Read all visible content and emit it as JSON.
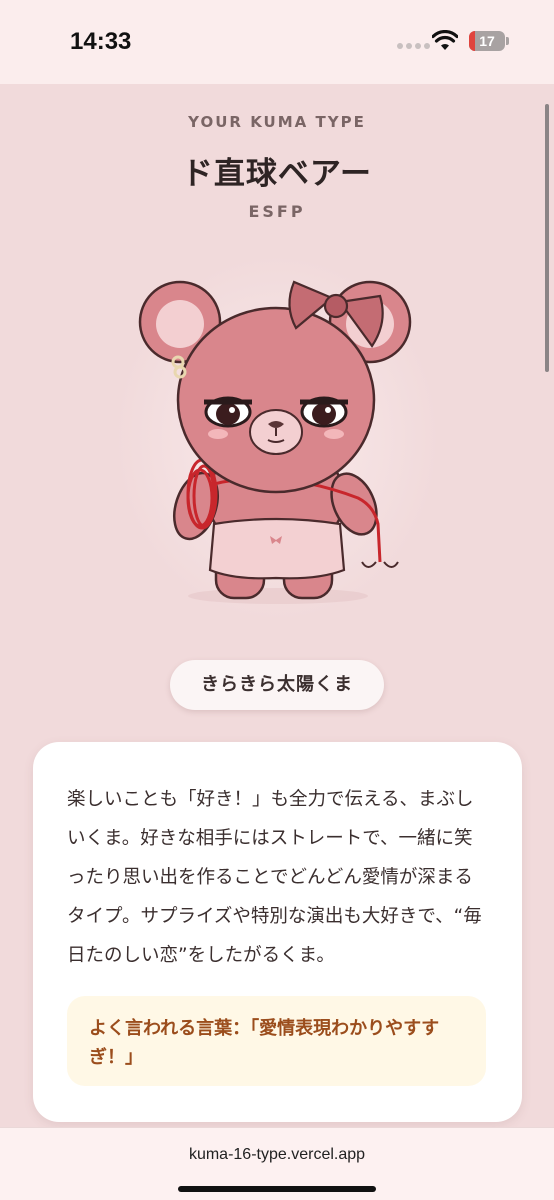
{
  "status_bar": {
    "time": "14:33",
    "battery_level": "17",
    "battery_fraction": 0.17
  },
  "header": {
    "eyebrow": "YOUR KUMA TYPE",
    "type_name": "ド直球ベアー",
    "type_code": "ESFP"
  },
  "illustration": {
    "icon": "pink-bear-with-rope-illustration"
  },
  "nickname": "きらきら太陽くま",
  "card": {
    "description": "楽しいことも「好き！」も全力で伝える、まぶしいくま。好きな相手にはストレートで、一緒に笑ったり思い出を作ることでどんどん愛情が深まるタイプ。サプライズや特別な演出も大好きで、“毎日たのしい恋”をしたがるくま。",
    "quote": "よく言われる言葉：「愛情表現わかりやすすぎ！」"
  },
  "browser": {
    "url": "kuma-16-type.vercel.app"
  },
  "colors": {
    "background": "#f1dadb",
    "card": "#ffffff",
    "quote_bg": "#fff8e6",
    "quote_text": "#9b4d1c",
    "bear": "#d9868c"
  }
}
